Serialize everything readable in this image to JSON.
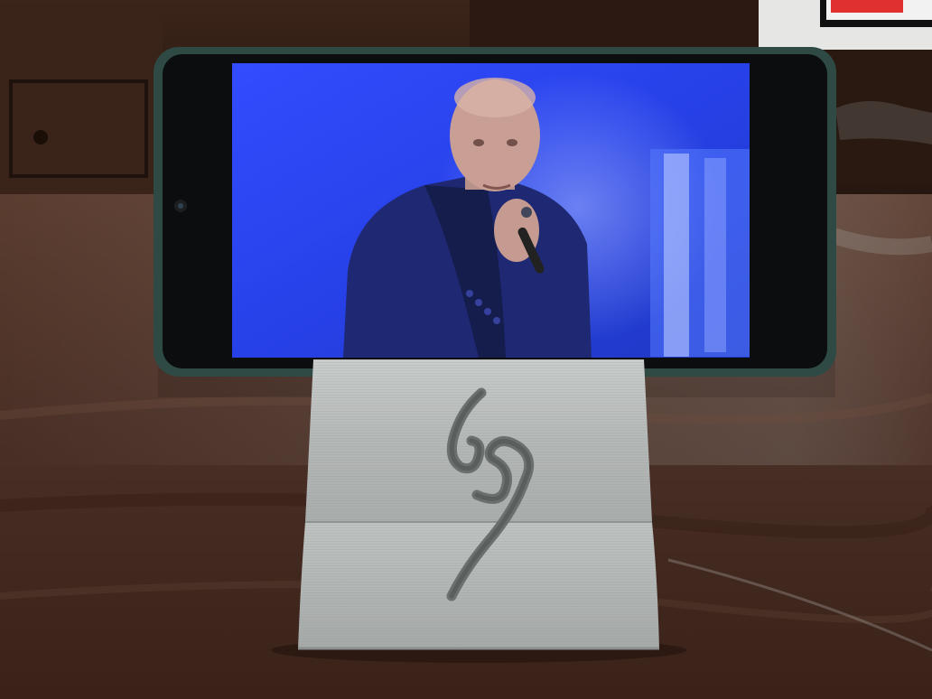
{
  "scene": {
    "description_visible_text": [],
    "objects": {
      "phone": {
        "orientation": "landscape",
        "screen_content": "concert-video"
      },
      "stand": {
        "material": "3d-printed-gray",
        "emblem": "engraved-monogram"
      },
      "tv": {
        "accent_color": "#e03030"
      }
    },
    "colors": {
      "table": "#4a3026",
      "cabinet": "#2e1c14",
      "wall": "#e8e8e6",
      "stage_blue": "#1e3cf0",
      "stand_gray": "#b9bdbc",
      "phone_case": "#2f4a44"
    }
  }
}
